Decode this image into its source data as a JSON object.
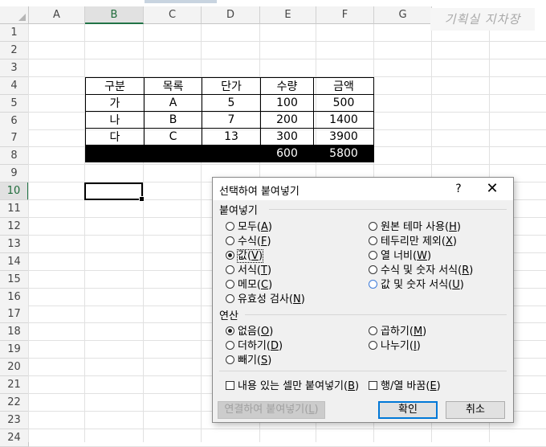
{
  "watermark": "기획실 지차장",
  "columns": [
    "A",
    "B",
    "C",
    "D",
    "E",
    "F",
    "G"
  ],
  "rows": [
    "1",
    "2",
    "3",
    "4",
    "5",
    "6",
    "7",
    "8",
    "9",
    "10",
    "11",
    "12",
    "13",
    "14",
    "15",
    "16",
    "17",
    "18",
    "19",
    "20",
    "21",
    "22",
    "23",
    "24"
  ],
  "table": {
    "headers": [
      "구분",
      "목록",
      "단가",
      "수량",
      "금액"
    ],
    "rows": [
      [
        "가",
        "A",
        "5",
        "100",
        "500"
      ],
      [
        "나",
        "B",
        "7",
        "200",
        "1400"
      ],
      [
        "다",
        "C",
        "13",
        "300",
        "3900"
      ]
    ],
    "total": [
      "",
      "",
      "",
      "600",
      "5800"
    ]
  },
  "dialog": {
    "title": "선택하여 붙여넣기",
    "help": "?",
    "close": "✕",
    "paste_section": "붙여넣기",
    "paste_left": [
      {
        "label": "모두(",
        "key": "A",
        "end": ")"
      },
      {
        "label": "수식(",
        "key": "F",
        "end": ")"
      },
      {
        "label": "값(",
        "key": "V",
        "end": ")"
      },
      {
        "label": "서식(",
        "key": "T",
        "end": ")"
      },
      {
        "label": "메모(",
        "key": "C",
        "end": ")"
      },
      {
        "label": "유효성 검사(",
        "key": "N",
        "end": ")"
      }
    ],
    "paste_right": [
      {
        "label": "원본 테마 사용(",
        "key": "H",
        "end": ")"
      },
      {
        "label": "테두리만 제외(",
        "key": "X",
        "end": ")"
      },
      {
        "label": "열 너비(",
        "key": "W",
        "end": ")"
      },
      {
        "label": "수식 및 숫자 서식(",
        "key": "R",
        "end": ")"
      },
      {
        "label": "값 및 숫자 서식(",
        "key": "U",
        "end": ")"
      }
    ],
    "op_section": "연산",
    "op_left": [
      {
        "label": "없음(",
        "key": "O",
        "end": ")"
      },
      {
        "label": "더하기(",
        "key": "D",
        "end": ")"
      },
      {
        "label": "빼기(",
        "key": "S",
        "end": ")"
      }
    ],
    "op_right": [
      {
        "label": "곱하기(",
        "key": "M",
        "end": ")"
      },
      {
        "label": "나누기(",
        "key": "I",
        "end": ")"
      }
    ],
    "skip_blanks": {
      "label": "내용 있는 셀만 붙여넣기(",
      "key": "B",
      "end": ")"
    },
    "transpose": {
      "label": "행/열 바꿈(",
      "key": "E",
      "end": ")"
    },
    "paste_link": {
      "label": "연결하여 붙여넣기(",
      "key": "L",
      "end": ")"
    },
    "ok": "확인",
    "cancel": "취소"
  }
}
